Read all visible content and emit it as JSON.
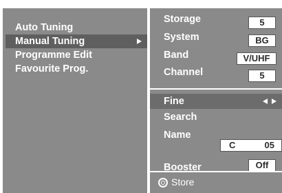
{
  "menu": {
    "items": [
      {
        "label": "Auto Tuning",
        "selected": false
      },
      {
        "label": "Manual Tuning",
        "selected": true
      },
      {
        "label": "Programme Edit",
        "selected": false
      },
      {
        "label": "Favourite Prog.",
        "selected": false
      }
    ]
  },
  "settings": {
    "storage": {
      "label": "Storage",
      "value": "5"
    },
    "system": {
      "label": "System",
      "value": "BG"
    },
    "band": {
      "label": "Band",
      "value": "V/UHF"
    },
    "channel": {
      "label": "Channel",
      "value": "5"
    },
    "fine": {
      "label": "Fine"
    },
    "search": {
      "label": "Search"
    },
    "name": {
      "label": "Name",
      "value_prefix": "C",
      "value_number": "05"
    },
    "booster": {
      "label": "Booster",
      "value": "Off"
    }
  },
  "footer": {
    "store_label": "Store"
  },
  "colors": {
    "background": "#ffffff",
    "panel": "#8a8a8a",
    "highlight": "#6c6c6c",
    "text": "#ffffff",
    "value_text": "#2b2b2b"
  },
  "icons": {
    "submenu": "triangle-right-icon",
    "adjust": "left-right-arrows-icon",
    "store": "ok-button-icon"
  }
}
